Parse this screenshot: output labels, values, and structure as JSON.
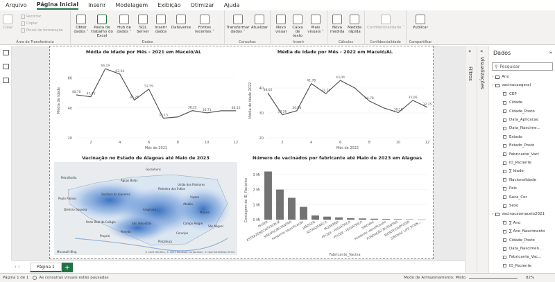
{
  "menu": {
    "items": [
      "Arquivo",
      "Página Inicial",
      "Inserir",
      "Modelagem",
      "Exibição",
      "Otimizar",
      "Ajuda"
    ],
    "active": "Página Inicial"
  },
  "ribbon": {
    "clipboard": {
      "paste": "Colar",
      "cut": "Recortar",
      "copy": "Copiar",
      "format": "Pincel de formatação",
      "group": "Área de Transferência"
    },
    "data": {
      "get": "Obter dados ˅",
      "excel": "Pasta de trabalho do Excel",
      "hub": "Hub de dados ˅",
      "sql": "SQL Server",
      "enter": "Inserir dados",
      "dataverse": "Dataverse",
      "recent": "Fontes recentes ˅",
      "group": "Dados"
    },
    "queries": {
      "transform": "Transformar dados ˅",
      "refresh": "Atualizar",
      "group": "Consultas"
    },
    "insert": {
      "visual": "Novo visual",
      "text": "Caixa de texto",
      "more": "Mais visuais ˅",
      "group": "Inserir"
    },
    "calc": {
      "measure": "Nova medida",
      "quick": "Medida rápida",
      "group": "Cálculos"
    },
    "sens": {
      "label": "Confidencialidade ˅",
      "group": "Confidencialidade"
    },
    "share": {
      "publish": "Publicar",
      "group": "Compartilhar"
    }
  },
  "charts": {
    "c2021": {
      "title": "Média de Idade por Mês - 2021 em Maceió/AL",
      "xlabel": "Mês de 2021",
      "ylabel": "Média de Idade"
    },
    "c2022": {
      "title": "Média de Idade por Mês - 2022 em Maceió/AL",
      "xlabel": "Mês de 2022",
      "ylabel": "Média de Idade 2022"
    },
    "map": {
      "title": "Vacinação no Estado de Alagoas até Maio de 2023",
      "attribution": "© 2023 TomTom, © 2023 Microsoft Corporation, © OpenStreetMap Terms",
      "brand": "Microsoft Bing"
    },
    "bar": {
      "title": "Número de vacinados por fabricante até Maio de 2023 em Alagoas",
      "xlabel": "Fabricante_Vacina",
      "ylabel": "Contagem de ID_Paciente"
    }
  },
  "chart_data": [
    {
      "type": "line",
      "title": "Média de Idade por Mês - 2021 em Maceió/AL",
      "xlabel": "Mês de 2021",
      "ylabel": "Média de Idade",
      "x": [
        1,
        2,
        3,
        4,
        5,
        6,
        7,
        8,
        9,
        10,
        11,
        12
      ],
      "values": [
        48.7,
        47.45,
        66.19,
        62.64,
        45.26,
        52.59,
        33.13,
        34.0,
        38.22,
        36.71,
        38.1,
        38.1
      ],
      "labels": [
        "48,70",
        "47,45",
        "66,19",
        "62,64",
        "45,26",
        "52,59",
        "33,13",
        "",
        "38,22",
        "36,71",
        "",
        "38,10"
      ],
      "ylim": [
        20,
        70
      ],
      "yticks": [
        20,
        40,
        60
      ],
      "xticks": [
        2,
        4,
        6,
        8,
        10,
        12
      ]
    },
    {
      "type": "line",
      "title": "Média de Idade por Mês - 2022 em Maceió/AL",
      "xlabel": "Mês de 2022",
      "ylabel": "Média de Idade 2022",
      "x": [
        1,
        2,
        3,
        4,
        5,
        6,
        7,
        8,
        9,
        10,
        11,
        12
      ],
      "values": [
        38.02,
        29.26,
        30.88,
        41.78,
        37.74,
        43.04,
        40.0,
        34.78,
        32.0,
        30.16,
        35.06,
        32.25
      ],
      "labels": [
        "38,02",
        "29,26",
        "30,88",
        "41,78",
        "37,74",
        "43,04",
        "",
        "34,78",
        "",
        "30,16",
        "35,06",
        "32,25"
      ],
      "ylim": [
        20,
        50
      ],
      "yticks": [
        20,
        30,
        40
      ],
      "xticks": [
        2,
        4,
        6,
        8,
        10,
        12
      ]
    },
    {
      "type": "bar",
      "title": "Número de vacinados por fabricante até Maio de 2023 em Alagoas",
      "xlabel": "Fabricante_Vacina",
      "ylabel": "Contagem de ID_Paciente",
      "categories": [
        "PFIZER",
        "ASTRAZENECA/FIOCRUZ",
        "SINOVAC/BUTANTAN",
        "Pendente identificação",
        "JANSSEN",
        "ASTRAZENECA",
        "MODERNA",
        "PFIZER - PEDIÁTRICA",
        "PFIZER - PEDIÁTRICA",
        "SINOVAC",
        "Pendente identificação",
        "FUNDAÇÃO BUTANTAN",
        "BIONTECH/PFIZER",
        "SINOVAC LIFE SCIEN..."
      ],
      "values": [
        3.2,
        2.0,
        1.45,
        0.85,
        0.28,
        0.2,
        0.15,
        0.1,
        0.08,
        0.06,
        0.04,
        0.03,
        0.02,
        0.01
      ],
      "yticks": [
        "0 Mi",
        "1 Mi",
        "2 Mi",
        "3 Mi"
      ],
      "ylim": [
        0,
        3.5
      ]
    }
  ],
  "map_places": [
    "Garanhuns",
    "Petrolândia",
    "Palmeira dos Índios",
    "Águas Belas",
    "Santana do Ipanema",
    "União dos Palmares",
    "Paulo Afonso",
    "Arapiraca",
    "Maceió",
    "Penedo",
    "Campo Alegre",
    "Piaçabuçu",
    "Propriá",
    "Porto Real do Colégio",
    "Delmiro Gouveia",
    "São Sebastião",
    "Viçosa",
    "Atalaia",
    "Coruripe",
    "São Miguel"
  ],
  "tabs": {
    "page1": "Página 1",
    "add": "+"
  },
  "status": {
    "page": "Página 1 de 1",
    "msg": "As consultas visuais estão pausadas",
    "mode": "Modo de Armazenamento: Misto",
    "zoom": "82%"
  },
  "panes": {
    "filters": "Filtros",
    "visuals": "Visualizações",
    "data": "Dados",
    "search": "Pesquisar"
  },
  "fields": [
    {
      "label": "Ano",
      "kind": "table",
      "level": 0
    },
    {
      "label": "vacinacaogeral",
      "kind": "table",
      "level": 0
    },
    {
      "label": "CEP",
      "kind": "field",
      "level": 1
    },
    {
      "label": "Cidade",
      "kind": "field",
      "level": 1
    },
    {
      "label": "Cidade_Posto",
      "kind": "field",
      "level": 1
    },
    {
      "label": "Data_Aplicacao",
      "kind": "field",
      "level": 1
    },
    {
      "label": "Data_Nascime...",
      "kind": "field",
      "level": 1
    },
    {
      "label": "Estado",
      "kind": "field",
      "level": 1
    },
    {
      "label": "Estado_Posto",
      "kind": "field",
      "level": 1
    },
    {
      "label": "Fabricante_Vaci",
      "kind": "field",
      "level": 1
    },
    {
      "label": "ID_Paciente",
      "kind": "field",
      "level": 1
    },
    {
      "label": "∑ Idade",
      "kind": "field",
      "level": 1
    },
    {
      "label": "Nacionalidade",
      "kind": "field",
      "level": 1
    },
    {
      "label": "Pais",
      "kind": "field",
      "level": 1
    },
    {
      "label": "Raca_Cor",
      "kind": "field",
      "level": 1
    },
    {
      "label": "Sexo",
      "kind": "field",
      "level": 1
    },
    {
      "label": "vacinacaomaceio2021",
      "kind": "table",
      "level": 0
    },
    {
      "label": "∑ Ano",
      "kind": "field",
      "level": 1
    },
    {
      "label": "∑ Ano_Nascimento",
      "kind": "field",
      "level": 1
    },
    {
      "label": "Cidade_Posto",
      "kind": "field",
      "level": 1
    },
    {
      "label": "Data_Nascimen...",
      "kind": "field",
      "level": 1
    },
    {
      "label": "Fabricante_Vac...",
      "kind": "field",
      "level": 1
    },
    {
      "label": "ID_Paciente",
      "kind": "field",
      "level": 1
    }
  ]
}
